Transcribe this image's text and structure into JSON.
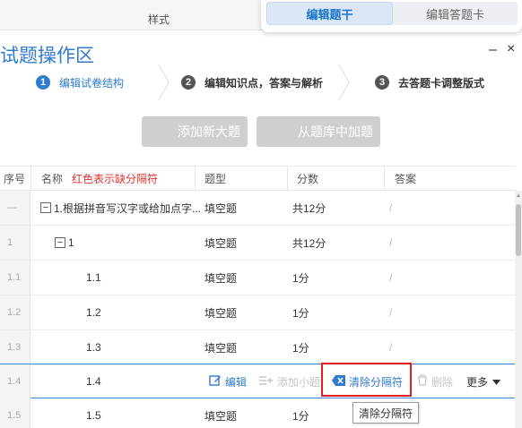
{
  "topbar": {
    "style_label": "样式"
  },
  "switcher": {
    "tabs": [
      {
        "label": "编辑题干",
        "active": true
      },
      {
        "label": "编辑答题卡",
        "active": false
      }
    ]
  },
  "panel": {
    "title": "试题操作区",
    "min_glyph": "–",
    "close_glyph": "×"
  },
  "steps": [
    {
      "num": "1",
      "label": "编辑试卷结构",
      "active": true
    },
    {
      "num": "2",
      "label": "编辑知识点，答案与解析",
      "active": false
    },
    {
      "num": "3",
      "label": "去答题卡调整版式",
      "active": false
    }
  ],
  "actions": {
    "add_section": "添加新大题",
    "add_from_bank": "从题库中加题"
  },
  "table": {
    "headers": {
      "seq": "序号",
      "name": "名称",
      "name_hint": "红色表示缺分隔符",
      "type": "题型",
      "score": "分数",
      "answer": "答案"
    },
    "rows": [
      {
        "seq": "—",
        "toggle": "−",
        "name": "1.根据拼音写汉字或给加点字...",
        "type": "填空题",
        "score": "共12分",
        "answer": "/"
      },
      {
        "seq": "1",
        "toggle": "−",
        "name": "1",
        "type": "填空题",
        "score": "共12分",
        "answer": "/"
      },
      {
        "seq": "1.1",
        "name": "1.1",
        "type": "填空题",
        "score": "1分",
        "answer": "/"
      },
      {
        "seq": "1.2",
        "name": "1.2",
        "type": "填空题",
        "score": "1分",
        "answer": "/"
      },
      {
        "seq": "1.3",
        "name": "1.3",
        "type": "填空题",
        "score": "1分",
        "answer": "/"
      },
      {
        "seq": "1.4",
        "name": "1.4"
      },
      {
        "seq": "1.5",
        "name": "1.5",
        "type": "填空题",
        "score": "1分"
      }
    ]
  },
  "row_actions": {
    "edit": "编辑",
    "add_sub": "添加小题",
    "clear_sep": "清除分隔符",
    "delete": "删除",
    "more": "更多"
  },
  "tooltip": {
    "text": "清除分隔符"
  },
  "colors": {
    "accent": "#2f7bd0",
    "highlight_red": "#e02020",
    "disabled_button": "#cfcfcf"
  }
}
